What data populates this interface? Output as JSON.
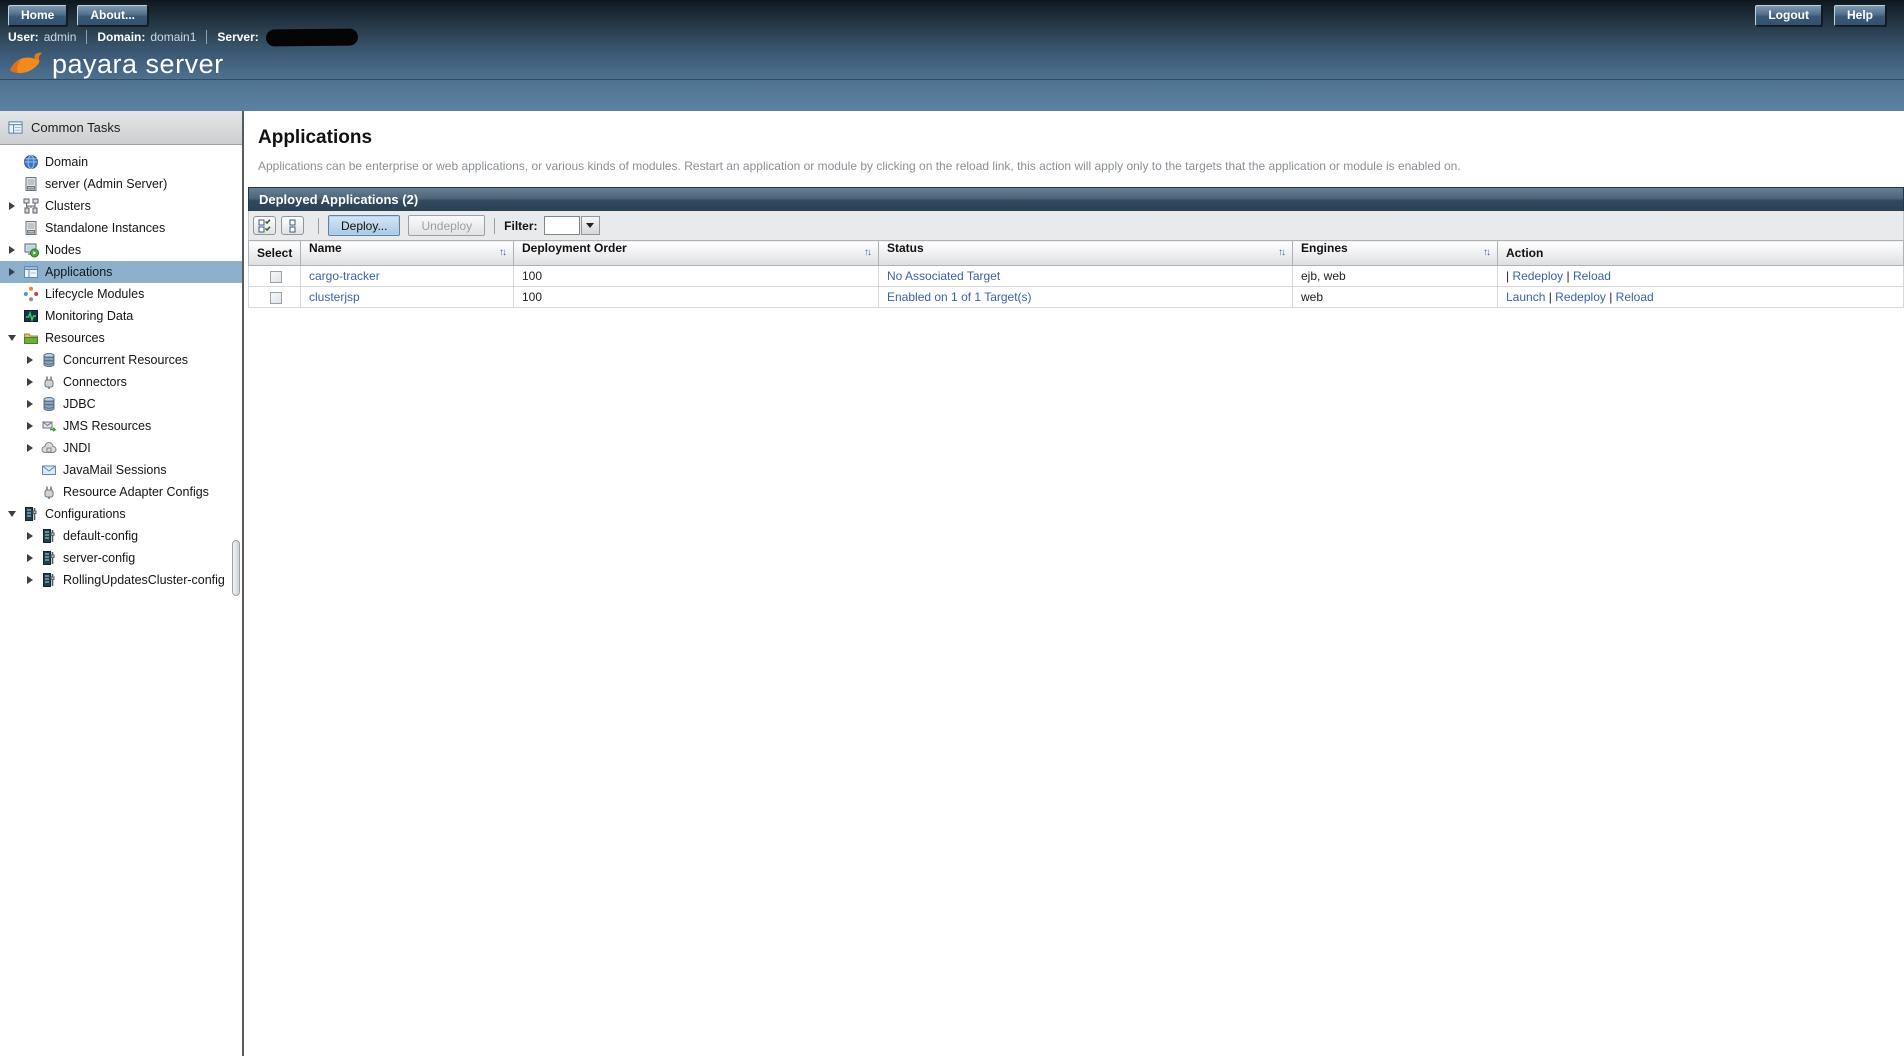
{
  "topbar": {
    "home": "Home",
    "about": "About...",
    "logout": "Logout",
    "help": "Help"
  },
  "userbar": {
    "user_label": "User:",
    "user_value": "admin",
    "domain_label": "Domain:",
    "domain_value": "domain1",
    "server_label": "Server:",
    "server_value_redacted": true
  },
  "brand": {
    "logo_text": "payara server",
    "fish_icon": "payara-fish-icon"
  },
  "sidebar": {
    "header": {
      "label": "Common Tasks",
      "icon": "common-tasks-icon"
    },
    "items": [
      {
        "label": "Domain",
        "icon": "domain-globe-icon",
        "level": 0,
        "expander": "none",
        "selected": false
      },
      {
        "label": "server (Admin Server)",
        "icon": "server-icon",
        "level": 0,
        "expander": "none",
        "selected": false
      },
      {
        "label": "Clusters",
        "icon": "clusters-icon",
        "level": 0,
        "expander": "collapsed",
        "selected": false
      },
      {
        "label": "Standalone Instances",
        "icon": "server-icon",
        "level": 0,
        "expander": "none",
        "selected": false
      },
      {
        "label": "Nodes",
        "icon": "nodes-icon",
        "level": 0,
        "expander": "collapsed",
        "selected": false
      },
      {
        "label": "Applications",
        "icon": "applications-icon",
        "level": 0,
        "expander": "collapsed",
        "selected": true
      },
      {
        "label": "Lifecycle Modules",
        "icon": "lifecycle-icon",
        "level": 0,
        "expander": "none",
        "selected": false
      },
      {
        "label": "Monitoring Data",
        "icon": "monitoring-icon",
        "level": 0,
        "expander": "none",
        "selected": false
      },
      {
        "label": "Resources",
        "icon": "resources-folder-icon",
        "level": 0,
        "expander": "expanded",
        "selected": false
      },
      {
        "label": "Concurrent Resources",
        "icon": "database-icon",
        "level": 1,
        "expander": "collapsed",
        "selected": false
      },
      {
        "label": "Connectors",
        "icon": "connector-icon",
        "level": 1,
        "expander": "collapsed",
        "selected": false
      },
      {
        "label": "JDBC",
        "icon": "database-icon",
        "level": 1,
        "expander": "collapsed",
        "selected": false
      },
      {
        "label": "JMS Resources",
        "icon": "jms-icon",
        "level": 1,
        "expander": "collapsed",
        "selected": false
      },
      {
        "label": "JNDI",
        "icon": "jndi-icon",
        "level": 1,
        "expander": "collapsed",
        "selected": false
      },
      {
        "label": "JavaMail Sessions",
        "icon": "mail-icon",
        "level": 1,
        "expander": "none",
        "selected": false
      },
      {
        "label": "Resource Adapter Configs",
        "icon": "connector-icon",
        "level": 1,
        "expander": "none",
        "selected": false
      },
      {
        "label": "Configurations",
        "icon": "config-icon",
        "level": 0,
        "expander": "expanded",
        "selected": false
      },
      {
        "label": "default-config",
        "icon": "config-icon",
        "level": 1,
        "expander": "collapsed",
        "selected": false
      },
      {
        "label": "server-config",
        "icon": "config-icon",
        "level": 1,
        "expander": "collapsed",
        "selected": false
      },
      {
        "label": "RollingUpdatesCluster-config",
        "icon": "config-icon",
        "level": 1,
        "expander": "collapsed",
        "selected": false
      }
    ]
  },
  "main": {
    "title": "Applications",
    "description": "Applications can be enterprise or web applications, or various kinds of modules. Restart an application or module by clicking on the reload link, this action will apply only to the targets that the application or module is enabled on.",
    "panel": {
      "title": "Deployed Applications (2)",
      "toolbar": {
        "select_all_icon": "select-all-icon",
        "deselect_all_icon": "deselect-all-icon",
        "deploy_label": "Deploy...",
        "undeploy_label": "Undeploy",
        "filter_label": "Filter:",
        "filter_value": ""
      },
      "table": {
        "columns": [
          {
            "label": "Select",
            "sortable": false
          },
          {
            "label": "Name",
            "sortable": true
          },
          {
            "label": "Deployment Order",
            "sortable": true
          },
          {
            "label": "Status",
            "sortable": true
          },
          {
            "label": "Engines",
            "sortable": true
          },
          {
            "label": "Action",
            "sortable": false
          }
        ],
        "rows": [
          {
            "selected": false,
            "name": "cargo-tracker",
            "deployment_order": "100",
            "status": "No Associated Target",
            "engines": "ejb, web",
            "action_prefix": "| ",
            "action_links": [
              "Redeploy",
              "Reload"
            ]
          },
          {
            "selected": false,
            "name": "clusterjsp",
            "deployment_order": "100",
            "status": "Enabled on 1 of 1 Target(s)",
            "engines": "web",
            "action_prefix": "",
            "action_links": [
              "Launch",
              "Redeploy",
              "Reload"
            ]
          }
        ]
      }
    }
  },
  "colors": {
    "link": "#3b61ab",
    "sidebar_selection": "#8cb0cc",
    "logo_orange": "#f28a1f",
    "banner_top": "#0d161e",
    "banner_bottom": "#5b80a3",
    "panel_title_bar": "#32495d"
  }
}
